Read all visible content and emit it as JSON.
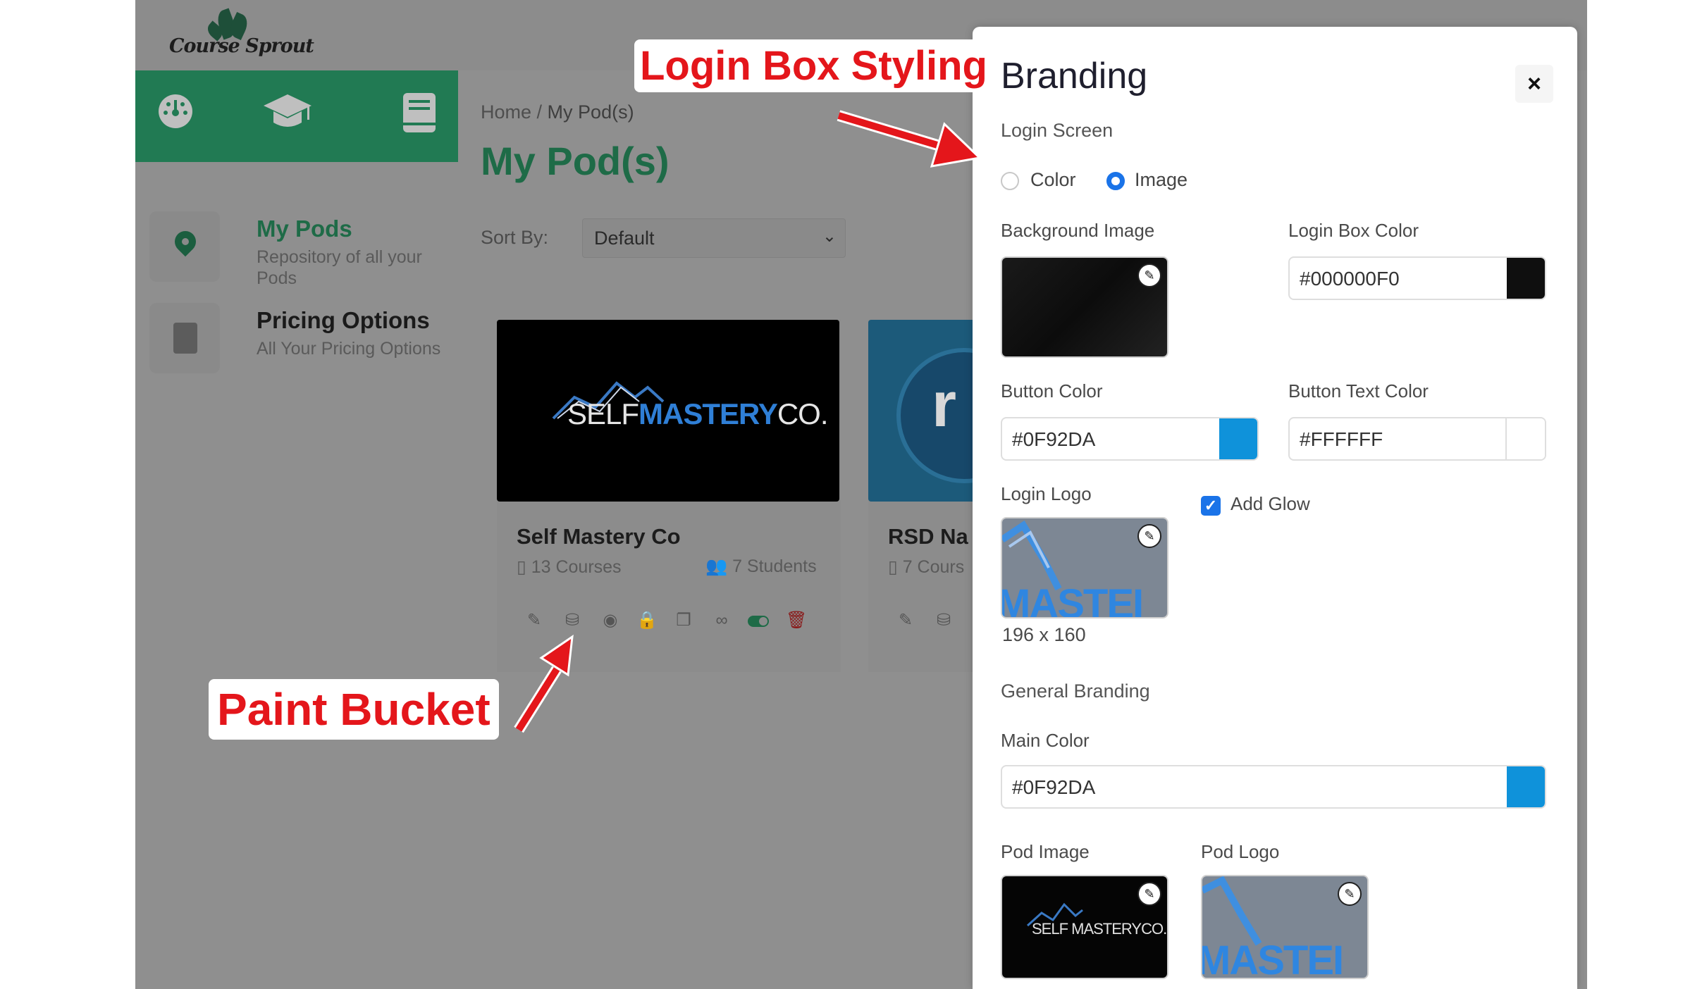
{
  "app": {
    "logo_text": "Course Sprout",
    "breadcrumb_home": "Home",
    "breadcrumb_sep": " / ",
    "breadcrumb_current": "My Pod(s)",
    "page_title": "My Pod(s)",
    "sort_label": "Sort By:",
    "sort_value": "Default",
    "sidebar": [
      {
        "title": "My Pods",
        "subtitle": "Repository of all your Pods"
      },
      {
        "title": "Pricing Options",
        "subtitle": "All Your Pricing Options"
      }
    ],
    "cards": [
      {
        "title": "Self Mastery Co",
        "courses": "13 Courses",
        "students": "7 Students",
        "brand_self": "SELF",
        "brand_mastery": "MASTERY",
        "brand_co": "CO."
      },
      {
        "title": "RSD Na",
        "courses": "7 Cours"
      }
    ]
  },
  "modal": {
    "title": "Branding",
    "close_label": "×",
    "login_screen_heading": "Login Screen",
    "radio_color": "Color",
    "radio_image": "Image",
    "background_image_label": "Background Image",
    "login_box_color_label": "Login Box Color",
    "login_box_color_value": "#000000F0",
    "button_color_label": "Button Color",
    "button_color_value": "#0F92DA",
    "button_text_color_label": "Button Text Color",
    "button_text_color_value": "#FFFFFF",
    "login_logo_label": "Login Logo",
    "add_glow_label": "Add Glow",
    "logo_size": "196 x 160",
    "general_branding_heading": "General Branding",
    "main_color_label": "Main Color",
    "main_color_value": "#0F92DA",
    "pod_image_label": "Pod Image",
    "pod_logo_label": "Pod Logo",
    "logo_partial_text": "MASTEI",
    "pod_image_brand": "SELF MASTERYCO."
  },
  "annotations": {
    "login_box_styling": "Login Box Styling",
    "paint_bucket": "Paint Bucket"
  },
  "colors": {
    "accent_blue": "#0F92DA",
    "brand_green": "#217A53",
    "annotation_red": "#E4161B"
  }
}
